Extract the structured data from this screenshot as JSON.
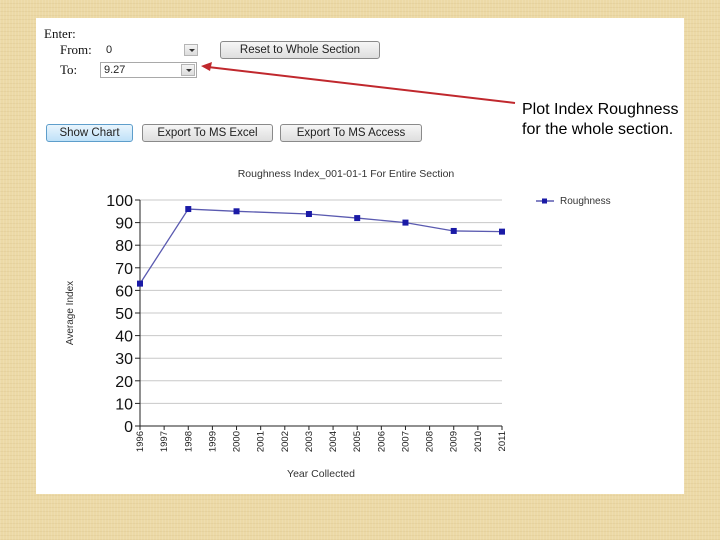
{
  "form": {
    "enter_label": "Enter:",
    "from_label": "From:",
    "from_value": "0",
    "to_label": "To:",
    "to_value": "9.27",
    "reset_button": "Reset to Whole Section"
  },
  "toolbar": {
    "show_chart": "Show Chart",
    "export_excel": "Export To MS Excel",
    "export_access": "Export To MS Access"
  },
  "annotation": {
    "text": "Plot Index Roughness for the whole section.",
    "arrow_color": "#c0282d"
  },
  "chart_data": {
    "type": "line",
    "title": "Roughness Index_001-01-1 For Entire Section",
    "xlabel": "Year Collected",
    "ylabel": "Average Index",
    "x_ticks": [
      "1996",
      "1997",
      "1998",
      "1999",
      "2000",
      "2001",
      "2002",
      "2003",
      "2004",
      "2005",
      "2006",
      "2007",
      "2008",
      "2009",
      "2010",
      "2011"
    ],
    "y_ticks": [
      0,
      10,
      20,
      30,
      40,
      50,
      60,
      70,
      80,
      90,
      100
    ],
    "xlim": [
      1996,
      2011
    ],
    "ylim": [
      0,
      100
    ],
    "grid": true,
    "legend": "top-right",
    "series": [
      {
        "name": "Roughness",
        "color": "#1a1aa6",
        "points": [
          {
            "x": 1996,
            "y": 63
          },
          {
            "x": 1998,
            "y": 96
          },
          {
            "x": 2000,
            "y": 95
          },
          {
            "x": 2003,
            "y": 93.8
          },
          {
            "x": 2005,
            "y": 92
          },
          {
            "x": 2007,
            "y": 90
          },
          {
            "x": 2009,
            "y": 86.3
          },
          {
            "x": 2011,
            "y": 86
          }
        ]
      }
    ]
  }
}
